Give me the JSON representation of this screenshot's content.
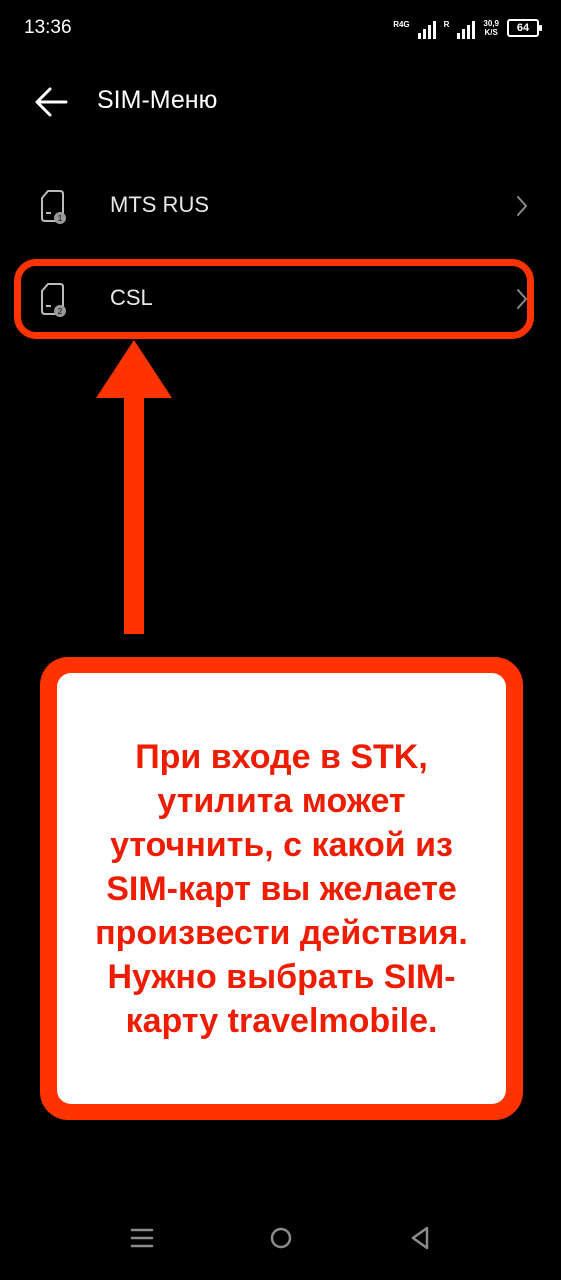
{
  "status_bar": {
    "time": "13:36",
    "sim1_net": "R4G",
    "sim2_net": "R",
    "speed_value": "30,9",
    "speed_unit": "K/S",
    "battery": "64"
  },
  "header": {
    "back_icon": "arrow-left-icon",
    "title": "SIM-Меню"
  },
  "sim_list": [
    {
      "label": "MTS RUS",
      "slot": "1",
      "icon": "sim-card-icon"
    },
    {
      "label": "CSL",
      "slot": "2",
      "icon": "sim-card-icon"
    }
  ],
  "annotation": {
    "text": "При входе в STK,\nутилита может\nуточнить, с какой из\nSIM-карт вы желаете\nпроизвести действия.\nНужно выбрать SIM-\nкарту travelmobile.",
    "accent_color": "#ff3300"
  },
  "nav_bar": {
    "icons": [
      "menu-icon",
      "home-icon",
      "back-triangle-icon"
    ]
  }
}
